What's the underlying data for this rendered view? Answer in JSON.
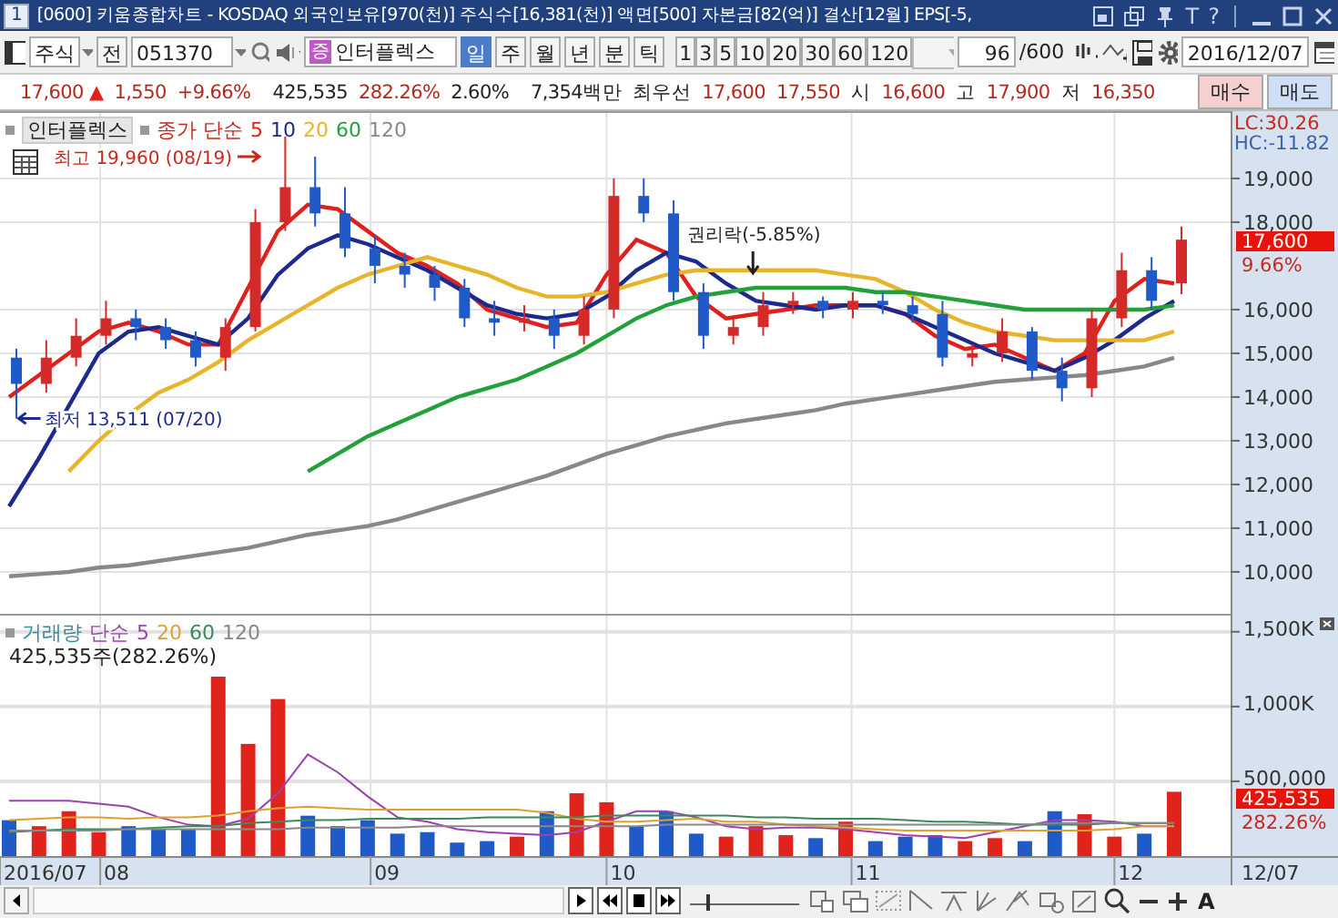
{
  "window": {
    "number": "1",
    "title": "[0600] 키움종합차트 - KOSDAQ 외국인보유[970(천)] 주식수[16,381(천)] 액면[500] 자본금[82(억)] 결산[12월] EPS[-5,",
    "buttons": [
      "T",
      "?"
    ]
  },
  "toolbar": {
    "market": "주식",
    "prev": "전",
    "code": "051370",
    "exchange_badge": "증",
    "name": "인터플렉스",
    "periods": [
      {
        "label": "일",
        "selected": true
      },
      {
        "label": "주",
        "selected": false
      },
      {
        "label": "월",
        "selected": false
      },
      {
        "label": "년",
        "selected": false
      },
      {
        "label": "분",
        "selected": false
      },
      {
        "label": "틱",
        "selected": false
      }
    ],
    "intervals": [
      "1",
      "3",
      "5",
      "10",
      "20",
      "30",
      "60",
      "120"
    ],
    "count": "96",
    "count_max": "/600",
    "date": "2016/12/07"
  },
  "quote": {
    "price": "17,600",
    "direction": "▲",
    "change": "1,550",
    "change_pct": "+9.66%",
    "volume": "425,535",
    "volume_ratio": "282.26%",
    "turnover": "2.60%",
    "amount": "7,354백만",
    "best_label": "최우선",
    "ask": "17,600",
    "bid": "17,550",
    "open_label": "시",
    "open": "16,600",
    "high_label": "고",
    "high": "17,900",
    "low_label": "저",
    "low": "16,350",
    "buy": "매수",
    "sell": "매도"
  },
  "price_chart": {
    "legend_name": "인터플렉스",
    "legend_label": "종가",
    "method": "단순",
    "lc": "LC:30.26",
    "hc": "HC:-11.82",
    "marker_price": "17,600",
    "marker_pct": "9.66%",
    "chart_data": {
      "type": "candlestick",
      "ylim": [
        9040,
        20540
      ],
      "grid": true,
      "ohlc": [
        [
          14900,
          15100,
          13511,
          14300
        ],
        [
          14300,
          15300,
          14100,
          14900
        ],
        [
          14900,
          15800,
          14700,
          15400
        ],
        [
          15400,
          16200,
          15200,
          15800
        ],
        [
          15800,
          16000,
          15300,
          15600
        ],
        [
          15600,
          15800,
          15100,
          15300
        ],
        [
          15300,
          15500,
          14700,
          14900
        ],
        [
          14900,
          15800,
          14600,
          15600
        ],
        [
          15600,
          18300,
          15500,
          18000
        ],
        [
          18000,
          19960,
          17800,
          18800
        ],
        [
          18800,
          19500,
          17900,
          18200
        ],
        [
          18200,
          18800,
          17200,
          17400
        ],
        [
          17400,
          17700,
          16600,
          17000
        ],
        [
          17000,
          17300,
          16500,
          16800
        ],
        [
          16800,
          17000,
          16200,
          16500
        ],
        [
          16500,
          16700,
          15600,
          15800
        ],
        [
          15800,
          16200,
          15400,
          15700
        ],
        [
          15700,
          16100,
          15500,
          15800
        ],
        [
          15800,
          16000,
          15100,
          15400
        ],
        [
          15400,
          16300,
          15200,
          16000
        ],
        [
          16000,
          19000,
          15800,
          18600
        ],
        [
          18600,
          19000,
          18000,
          18200
        ],
        [
          18200,
          18500,
          16200,
          16400
        ],
        [
          16400,
          16600,
          15100,
          15400
        ],
        [
          15400,
          15800,
          15200,
          15600
        ],
        [
          15600,
          16400,
          15400,
          16100
        ],
        [
          16100,
          16400,
          15900,
          16200
        ],
        [
          16200,
          16300,
          15800,
          16000
        ],
        [
          16000,
          16400,
          15800,
          16200
        ],
        [
          16200,
          16400,
          15900,
          16100
        ],
        [
          16100,
          16300,
          15700,
          15900
        ],
        [
          15900,
          16200,
          14700,
          14900
        ],
        [
          14900,
          15200,
          14700,
          15000
        ],
        [
          15000,
          15800,
          14800,
          15500
        ],
        [
          15500,
          15600,
          14400,
          14600
        ],
        [
          14600,
          14900,
          13900,
          14200
        ],
        [
          14200,
          16000,
          14000,
          15800
        ],
        [
          15800,
          17300,
          15600,
          16900
        ],
        [
          16900,
          17200,
          16000,
          16200
        ],
        [
          16600,
          17900,
          16350,
          17600
        ]
      ],
      "yticks": [
        {
          "value": 10000,
          "label": "10,000"
        },
        {
          "value": 11000,
          "label": "11,000"
        },
        {
          "value": 12000,
          "label": "12,000"
        },
        {
          "value": 13000,
          "label": "13,000"
        },
        {
          "value": 14000,
          "label": "14,000"
        },
        {
          "value": 15000,
          "label": "15,000"
        },
        {
          "value": 16000,
          "label": "16,000"
        },
        {
          "value": 18000,
          "label": "18,000"
        },
        {
          "value": 19000,
          "label": "19,000"
        }
      ],
      "series": [
        {
          "name": "5",
          "type": "line",
          "color": "#e0201c",
          "values": [
            14000,
            14500,
            15000,
            15500,
            15700,
            15500,
            15200,
            15200,
            16500,
            17800,
            18400,
            18300,
            17800,
            17300,
            17000,
            16600,
            16000,
            15800,
            15600,
            15700,
            16800,
            17600,
            17300,
            16300,
            15800,
            15900,
            16000,
            16100,
            16100,
            16100,
            15900,
            15400,
            15100,
            15200,
            14900,
            14600,
            15000,
            16200,
            16700,
            16600
          ]
        },
        {
          "name": "10",
          "type": "line",
          "color": "#1b2a8c",
          "values": [
            11500,
            12600,
            13800,
            15000,
            15500,
            15600,
            15400,
            15200,
            15800,
            16800,
            17400,
            17700,
            17500,
            17200,
            16900,
            16500,
            16100,
            15900,
            15800,
            15900,
            16300,
            16900,
            17300,
            17100,
            16600,
            16200,
            16100,
            16000,
            16100,
            16100,
            15900,
            15600,
            15300,
            15000,
            14800,
            14600,
            14900,
            15300,
            15800,
            16200
          ]
        },
        {
          "name": "20",
          "type": "line",
          "color": "#e8b42a",
          "values": [
            null,
            null,
            12300,
            13000,
            13600,
            14100,
            14400,
            14800,
            15300,
            15700,
            16100,
            16500,
            16800,
            17000,
            17200,
            17000,
            16800,
            16500,
            16300,
            16300,
            16400,
            16600,
            16800,
            16900,
            16900,
            16900,
            16900,
            16900,
            16800,
            16700,
            16400,
            16000,
            15700,
            15500,
            15400,
            15300,
            15300,
            15300,
            15300,
            15500
          ]
        },
        {
          "name": "60",
          "type": "line",
          "color": "#22a03a",
          "values": [
            null,
            null,
            null,
            null,
            null,
            null,
            null,
            null,
            null,
            null,
            12300,
            12700,
            13100,
            13400,
            13700,
            14000,
            14200,
            14400,
            14700,
            15000,
            15400,
            15800,
            16100,
            16300,
            16400,
            16500,
            16500,
            16500,
            16500,
            16400,
            16400,
            16300,
            16200,
            16100,
            16000,
            16000,
            16000,
            16000,
            16000,
            16100
          ]
        },
        {
          "name": "120",
          "type": "line",
          "color": "#888888",
          "values": [
            9900,
            9950,
            10000,
            10100,
            10150,
            10250,
            10350,
            10450,
            10550,
            10700,
            10850,
            10950,
            11050,
            11200,
            11400,
            11600,
            11800,
            12000,
            12200,
            12450,
            12700,
            12900,
            13100,
            13250,
            13400,
            13500,
            13600,
            13700,
            13850,
            13950,
            14050,
            14150,
            14250,
            14350,
            14400,
            14450,
            14500,
            14600,
            14700,
            14900
          ]
        }
      ],
      "annotations": [
        "최고 19,960 (08/19)",
        "최저 13,511 (07/20)",
        "권리락(-5.85%)"
      ]
    }
  },
  "volume_chart": {
    "method": "단순",
    "info": "425,535주(282.26%)",
    "marker_volume": "425,535",
    "marker_pct": "282.26%",
    "months": [
      "2016/07",
      "08",
      "09",
      "10",
      "11",
      "12"
    ],
    "chart_data": {
      "type": "bar",
      "ylim": [
        0,
        1620000
      ],
      "grid": true,
      "yticks": [
        {
          "value": 500000,
          "label": "500,000"
        },
        {
          "value": 1000000,
          "label": "1,000K"
        },
        {
          "value": 1500000,
          "label": "1,500K"
        }
      ],
      "series": [
        {
          "name": "거래량",
          "colors": [
            "#1f5ac8",
            "#e0241c",
            "#e0241c",
            "#e0241c",
            "#1f5ac8",
            "#1f5ac8",
            "#1f5ac8",
            "#e0241c",
            "#e0241c",
            "#e0241c",
            "#1f5ac8",
            "#1f5ac8",
            "#1f5ac8",
            "#1f5ac8",
            "#1f5ac8",
            "#1f5ac8",
            "#1f5ac8",
            "#e0241c",
            "#1f5ac8",
            "#e0241c",
            "#e0241c",
            "#1f5ac8",
            "#1f5ac8",
            "#1f5ac8",
            "#e0241c",
            "#e0241c",
            "#e0241c",
            "#1f5ac8",
            "#e0241c",
            "#1f5ac8",
            "#1f5ac8",
            "#1f5ac8",
            "#e0241c",
            "#e0241c",
            "#1f5ac8",
            "#1f5ac8",
            "#e0241c",
            "#e0241c",
            "#1f5ac8",
            "#e0241c"
          ],
          "values": [
            240000,
            200000,
            300000,
            160000,
            200000,
            180000,
            180000,
            1200000,
            750000,
            1050000,
            270000,
            200000,
            240000,
            150000,
            160000,
            90000,
            100000,
            130000,
            300000,
            420000,
            360000,
            200000,
            300000,
            150000,
            130000,
            200000,
            140000,
            120000,
            230000,
            100000,
            130000,
            140000,
            100000,
            120000,
            100000,
            300000,
            280000,
            130000,
            150000,
            430000
          ]
        },
        {
          "name": "5",
          "type": "line",
          "color": "#a040b0",
          "values": [
            370000,
            370000,
            370000,
            350000,
            330000,
            260000,
            210000,
            200000,
            250000,
            420000,
            680000,
            560000,
            400000,
            260000,
            230000,
            180000,
            160000,
            150000,
            140000,
            160000,
            230000,
            300000,
            300000,
            260000,
            200000,
            180000,
            190000,
            190000,
            180000,
            160000,
            140000,
            130000,
            120000,
            160000,
            200000,
            240000,
            240000,
            230000,
            200000,
            200000
          ]
        },
        {
          "name": "20",
          "type": "line",
          "color": "#e0a030",
          "values": [
            240000,
            250000,
            260000,
            260000,
            250000,
            260000,
            260000,
            270000,
            300000,
            320000,
            330000,
            320000,
            310000,
            310000,
            310000,
            310000,
            310000,
            310000,
            290000,
            250000,
            230000,
            230000,
            240000,
            250000,
            230000,
            230000,
            210000,
            200000,
            190000,
            180000,
            170000,
            170000,
            170000,
            170000,
            170000,
            170000,
            170000,
            180000,
            200000,
            200000
          ]
        },
        {
          "name": "60",
          "type": "line",
          "color": "#3a8a5a",
          "values": [
            160000,
            170000,
            180000,
            180000,
            180000,
            190000,
            200000,
            200000,
            220000,
            230000,
            240000,
            240000,
            250000,
            250000,
            250000,
            250000,
            260000,
            260000,
            260000,
            260000,
            270000,
            270000,
            270000,
            270000,
            270000,
            260000,
            260000,
            250000,
            250000,
            250000,
            240000,
            230000,
            230000,
            220000,
            210000,
            210000,
            210000,
            220000,
            220000,
            220000
          ]
        },
        {
          "name": "120",
          "type": "line",
          "color": "#888888",
          "values": [
            170000,
            170000,
            170000,
            170000,
            180000,
            180000,
            180000,
            180000,
            180000,
            180000,
            190000,
            190000,
            190000,
            190000,
            200000,
            200000,
            200000,
            200000,
            200000,
            200000,
            200000,
            200000,
            210000,
            210000,
            210000,
            210000,
            210000,
            210000,
            210000,
            210000,
            210000,
            210000,
            210000,
            210000,
            210000,
            220000,
            220000,
            220000,
            220000,
            220000
          ]
        }
      ]
    }
  },
  "cursor_date": "12/07",
  "bottom_toolbar": {
    "zoom_slider": {
      "level": 0.15
    },
    "text_button": "A"
  }
}
